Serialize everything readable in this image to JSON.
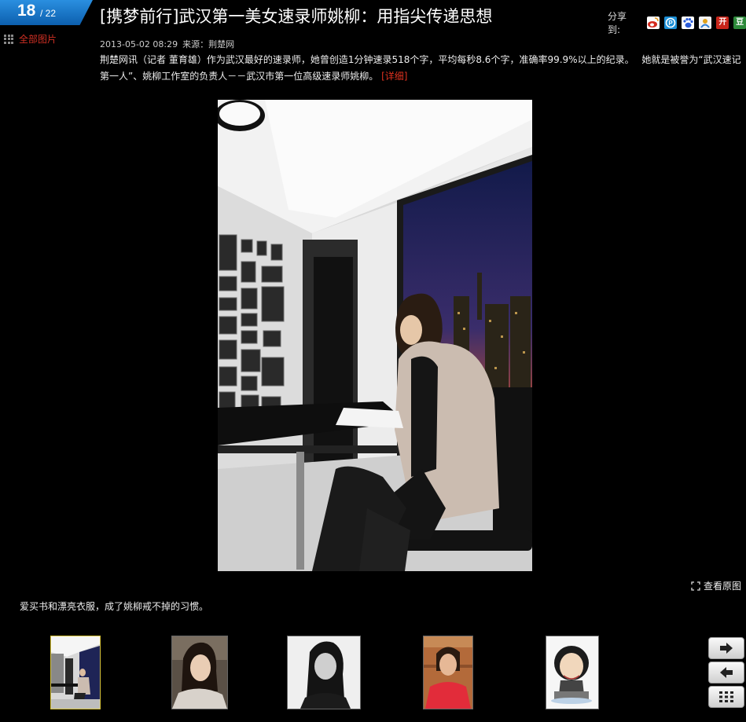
{
  "counter": {
    "current": "18",
    "total": "/ 22"
  },
  "sidebar": {
    "all_pictures": "全部图片"
  },
  "article": {
    "title": "[携梦前行]武汉第一美女速录师姚柳：用指尖传递思想",
    "date": "2013-05-02 08:29",
    "source": "来源：荆楚网",
    "description": "荆楚网讯（记者 董育雄）作为武汉最好的速录师，她曾创造1分钟速录518个字，平均每秒8.6个字，准确率99.9%以上的纪录。　 她就是被誉为“武汉速记第一人”、姚柳工作室的负责人－－武汉市第一位高级速录师姚柳。",
    "detail_link": "[详细]"
  },
  "share": {
    "label": "分享到:",
    "icons": [
      {
        "name": "weibo-icon",
        "color": "#d52b1e",
        "glyph": "微"
      },
      {
        "name": "qzone-icon",
        "color": "#1c8fd6",
        "glyph": "P"
      },
      {
        "name": "baidu-icon",
        "color": "#2a5bd7",
        "glyph": "百"
      },
      {
        "name": "renren-icon",
        "color": "#2f7fd4",
        "glyph": "人"
      },
      {
        "name": "kaixin-icon",
        "color": "#c8251a",
        "glyph": "开"
      },
      {
        "name": "douban-icon",
        "color": "#2d8a3a",
        "glyph": "豆"
      }
    ]
  },
  "photo": {
    "caption": "爱买书和漂亮衣服，成了姚柳戒不掉的习惯。"
  },
  "view_original": "查看原图",
  "colors": {
    "accent_red": "#d03024",
    "counter_blue": "#1a76cc",
    "active_border": "#d8c43a"
  }
}
